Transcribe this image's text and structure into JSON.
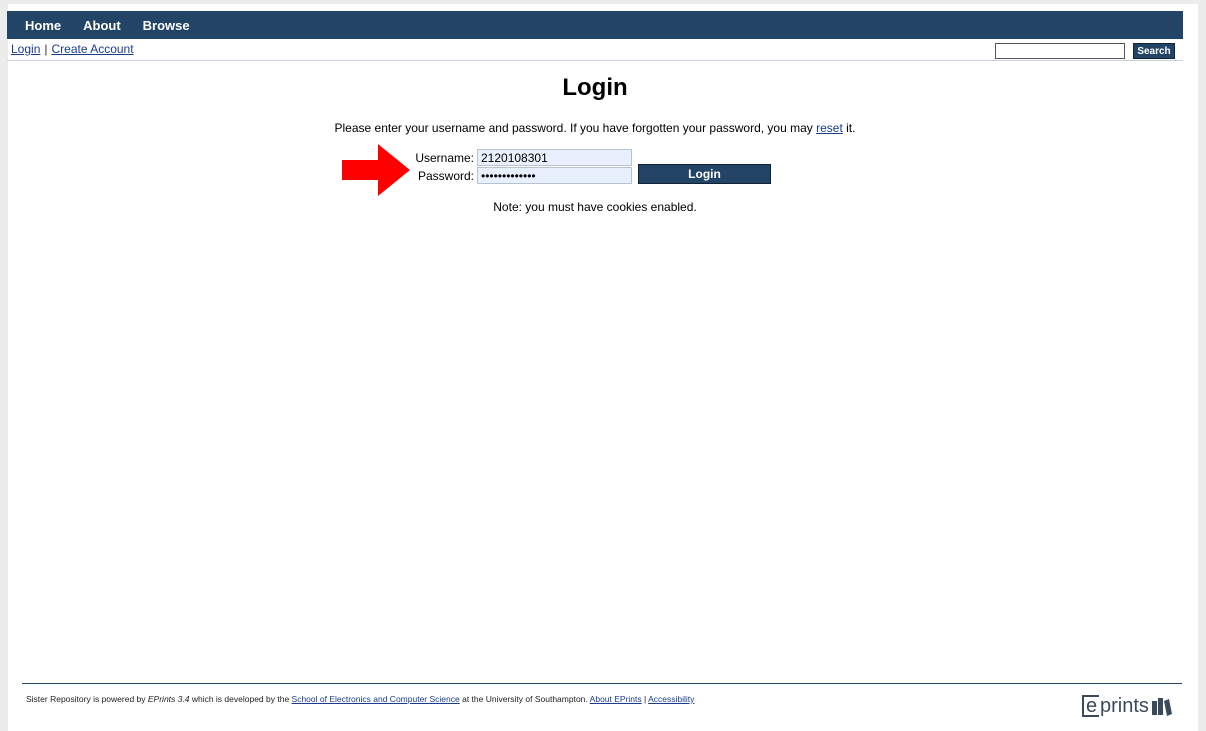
{
  "nav": {
    "items": [
      "Home",
      "About",
      "Browse"
    ]
  },
  "subbar": {
    "login_link": "Login",
    "separator": "|",
    "create_account_link": "Create Account",
    "search_value": "",
    "search_button": "Search"
  },
  "main": {
    "title": "Login",
    "intro_before": "Please enter your username and password. If you have forgotten your password, you may ",
    "intro_link": "reset",
    "intro_after": " it.",
    "username_label": "Username:",
    "username_value": "2120108301",
    "password_label": "Password:",
    "password_value": "•••••••••••••",
    "login_button": "Login",
    "note": "Note: you must have cookies enabled."
  },
  "footer": {
    "text_1": "Sister Repository is powered by ",
    "eprints_version": "EPrints 3.4",
    "text_2": " which is developed by the ",
    "school_link": "School of Electronics and Computer Science",
    "text_3": " at the University of Southampton. ",
    "about_link": "About EPrints",
    "sep": " | ",
    "accessibility_link": "Accessibility",
    "logo_e": "e",
    "logo_rest": "prints"
  },
  "colors": {
    "nav_bg": "#224466",
    "arrow": "#ff0000",
    "field_bg": "#e8f0fe"
  }
}
